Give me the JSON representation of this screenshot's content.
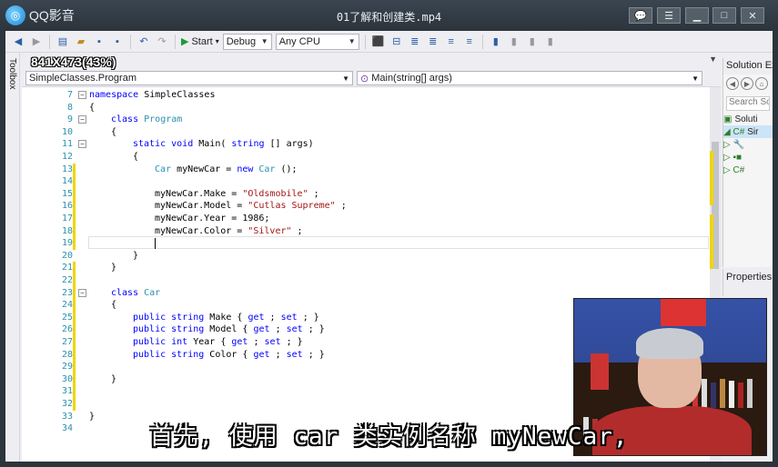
{
  "player": {
    "app_name": "QQ影音",
    "file_name": "01了解和创建类.mp4",
    "logo_icon": "qq-player-logo",
    "buttons": [
      {
        "name": "mini-mode-button",
        "icon": "chat-icon",
        "glyph": "💬"
      },
      {
        "name": "playlist-button",
        "icon": "list-icon",
        "glyph": "☰"
      },
      {
        "name": "minimize-button",
        "icon": "minimize-icon",
        "glyph": "▁"
      },
      {
        "name": "maximize-button",
        "icon": "maximize-icon",
        "glyph": "□"
      },
      {
        "name": "close-button",
        "icon": "close-icon",
        "glyph": "✕"
      }
    ],
    "frame_color": "#2c343c"
  },
  "vs": {
    "toolbar": {
      "start_label": "Start",
      "config_value": "Debug",
      "platform_value": "Any CPU"
    },
    "toolbox_label": "Toolbox",
    "size_overlay": "841X473(43%)",
    "nav": {
      "class_combo": "SimpleClasses.Program",
      "member_combo": "Main(string[] args)"
    },
    "code_lines": [
      {
        "n": "7",
        "segs": [
          [
            "kw",
            "namespace"
          ],
          [
            "",
            "SimpleClasses"
          ]
        ],
        "indent": 0,
        "fold": "−",
        "bar": false
      },
      {
        "n": "8",
        "segs": [
          [
            "",
            "{"
          ]
        ],
        "indent": 0,
        "fold": "",
        "bar": false
      },
      {
        "n": "9",
        "segs": [
          [
            "kw",
            "class"
          ],
          [
            "ty",
            "Program"
          ]
        ],
        "indent": 1,
        "fold": "−",
        "bar": false
      },
      {
        "n": "10",
        "segs": [
          [
            "",
            "{"
          ]
        ],
        "indent": 1,
        "fold": "",
        "bar": false
      },
      {
        "n": "11",
        "segs": [
          [
            "kw",
            "static"
          ],
          [
            "kw",
            "void"
          ],
          [
            "",
            "Main("
          ],
          [
            "kw",
            "string"
          ],
          [
            "",
            "[] args)"
          ]
        ],
        "indent": 2,
        "fold": "−",
        "bar": false
      },
      {
        "n": "12",
        "segs": [
          [
            "",
            "{"
          ]
        ],
        "indent": 2,
        "fold": "",
        "bar": false
      },
      {
        "n": "13",
        "segs": [
          [
            "ty",
            "Car"
          ],
          [
            "",
            "myNewCar ="
          ],
          [
            "kw",
            "new"
          ],
          [
            "ty",
            "Car"
          ],
          [
            "",
            "();"
          ]
        ],
        "indent": 3,
        "fold": "",
        "bar": true
      },
      {
        "n": "14",
        "segs": [],
        "indent": 3,
        "fold": "",
        "bar": true
      },
      {
        "n": "15",
        "segs": [
          [
            "",
            "myNewCar.Make ="
          ],
          [
            "str",
            "\"Oldsmobile\""
          ],
          [
            "",
            ";"
          ]
        ],
        "indent": 3,
        "fold": "",
        "bar": true
      },
      {
        "n": "16",
        "segs": [
          [
            "",
            "myNewCar.Model ="
          ],
          [
            "str",
            "\"Cutlas Supreme\""
          ],
          [
            "",
            ";"
          ]
        ],
        "indent": 3,
        "fold": "",
        "bar": true
      },
      {
        "n": "17",
        "segs": [
          [
            "",
            "myNewCar.Year = 1986;"
          ]
        ],
        "indent": 3,
        "fold": "",
        "bar": true
      },
      {
        "n": "18",
        "segs": [
          [
            "",
            "myNewCar.Color ="
          ],
          [
            "str",
            "\"Silver\""
          ],
          [
            "",
            ";"
          ]
        ],
        "indent": 3,
        "fold": "",
        "bar": true
      },
      {
        "n": "19",
        "segs": [],
        "indent": 3,
        "fold": "",
        "bar": true
      },
      {
        "n": "20",
        "segs": [
          [
            "",
            "}"
          ]
        ],
        "indent": 2,
        "fold": "",
        "bar": false
      },
      {
        "n": "21",
        "segs": [
          [
            "",
            "}"
          ]
        ],
        "indent": 1,
        "fold": "",
        "bar": true
      },
      {
        "n": "22",
        "segs": [],
        "indent": 0,
        "fold": "",
        "bar": true
      },
      {
        "n": "23",
        "segs": [
          [
            "kw",
            "class"
          ],
          [
            "ty",
            "Car"
          ]
        ],
        "indent": 1,
        "fold": "−",
        "bar": true
      },
      {
        "n": "24",
        "segs": [
          [
            "",
            "{"
          ]
        ],
        "indent": 1,
        "fold": "",
        "bar": true
      },
      {
        "n": "25",
        "segs": [
          [
            "kw",
            "public"
          ],
          [
            "kw",
            "string"
          ],
          [
            "",
            "Make {"
          ],
          [
            "kw",
            "get"
          ],
          [
            "",
            ";"
          ],
          [
            "kw",
            "set"
          ],
          [
            "",
            "; }"
          ]
        ],
        "indent": 2,
        "fold": "",
        "bar": true
      },
      {
        "n": "26",
        "segs": [
          [
            "kw",
            "public"
          ],
          [
            "kw",
            "string"
          ],
          [
            "",
            "Model {"
          ],
          [
            "kw",
            "get"
          ],
          [
            "",
            ";"
          ],
          [
            "kw",
            "set"
          ],
          [
            "",
            "; }"
          ]
        ],
        "indent": 2,
        "fold": "",
        "bar": true
      },
      {
        "n": "27",
        "segs": [
          [
            "kw",
            "public"
          ],
          [
            "kw",
            "int"
          ],
          [
            "",
            "Year {"
          ],
          [
            "kw",
            "get"
          ],
          [
            "",
            ";"
          ],
          [
            "kw",
            "set"
          ],
          [
            "",
            "; }"
          ]
        ],
        "indent": 2,
        "fold": "",
        "bar": true
      },
      {
        "n": "28",
        "segs": [
          [
            "kw",
            "public"
          ],
          [
            "kw",
            "string"
          ],
          [
            "",
            "Color {"
          ],
          [
            "kw",
            "get"
          ],
          [
            "",
            ";"
          ],
          [
            "kw",
            "set"
          ],
          [
            "",
            "; }"
          ]
        ],
        "indent": 2,
        "fold": "",
        "bar": true
      },
      {
        "n": "29",
        "segs": [],
        "indent": 2,
        "fold": "",
        "bar": true
      },
      {
        "n": "30",
        "segs": [
          [
            "",
            "}"
          ]
        ],
        "indent": 1,
        "fold": "",
        "bar": true
      },
      {
        "n": "31",
        "segs": [],
        "indent": 0,
        "fold": "",
        "bar": true
      },
      {
        "n": "32",
        "segs": [],
        "indent": 0,
        "fold": "",
        "bar": true
      },
      {
        "n": "33",
        "segs": [
          [
            "",
            "}"
          ]
        ],
        "indent": 0,
        "fold": "",
        "bar": false
      },
      {
        "n": "34",
        "segs": [],
        "indent": 0,
        "fold": "",
        "bar": false
      }
    ],
    "solution_explorer": {
      "title": "Solution Ex",
      "search_placeholder": "Search Solu",
      "items": [
        {
          "label": "Soluti",
          "glyph": "▣",
          "selected": false
        },
        {
          "label": "Sir",
          "glyph": "◢ C#",
          "selected": true
        },
        {
          "label": "",
          "glyph": "▷ 🔧",
          "selected": false
        },
        {
          "label": "",
          "glyph": "▷ ▪■",
          "selected": false
        },
        {
          "label": "",
          "glyph": "▷ C#",
          "selected": false
        }
      ]
    },
    "properties_title": "Properties"
  },
  "subtitle": "首先, 使用 car 类实例名称 myNewCar,",
  "colors": {
    "keyword": "#0000ff",
    "type": "#2b91af",
    "string": "#a31515",
    "change_bar": "#efd600"
  }
}
